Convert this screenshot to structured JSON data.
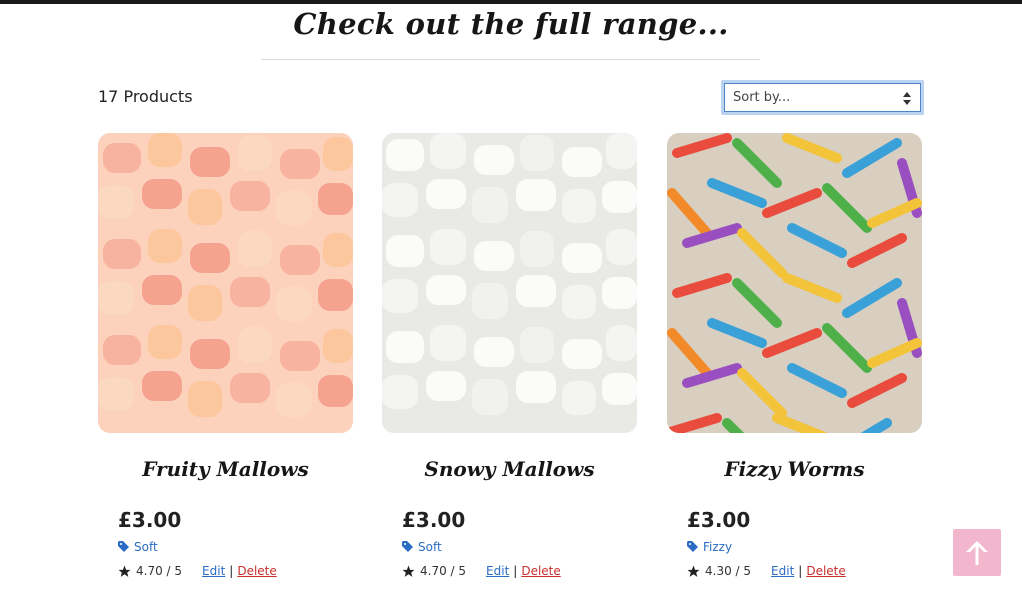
{
  "page": {
    "heading": "Check out the full range...",
    "product_count": "17 Products"
  },
  "sort": {
    "selected": "Sort by...",
    "icon": "sort-caret-icon"
  },
  "products": [
    {
      "name": "Fruity Mallows",
      "price": "£3.00",
      "category": "Soft",
      "rating": "4.70 / 5",
      "edit_label": "Edit",
      "separator": "|",
      "delete_label": "Delete",
      "image_palette": [
        "#fbd9c0",
        "#f7b39f",
        "#fcc79d",
        "#f5a38f"
      ]
    },
    {
      "name": "Snowy Mallows",
      "price": "£3.00",
      "category": "Soft",
      "rating": "4.70 / 5",
      "edit_label": "Edit",
      "separator": "|",
      "delete_label": "Delete",
      "image_palette": [
        "#f4f4f2",
        "#e6e6e2",
        "#fbfbfa",
        "#dcdcd7"
      ]
    },
    {
      "name": "Fizzy Worms",
      "price": "£3.00",
      "category": "Fizzy",
      "rating": "4.30 / 5",
      "edit_label": "Edit",
      "separator": "|",
      "delete_label": "Delete",
      "image_palette": [
        "#e94b3c",
        "#f3c43a",
        "#4fb04a",
        "#3aa0d8",
        "#9a4fc0",
        "#f28a2a"
      ]
    }
  ],
  "scroll_top": {
    "icon": "arrow-up-icon"
  },
  "colors": {
    "link": "#2b6cc4",
    "delete": "#c9302c",
    "scroll_top_bg": "#f3b7cd",
    "sort_focus": "#b9d3f0"
  }
}
